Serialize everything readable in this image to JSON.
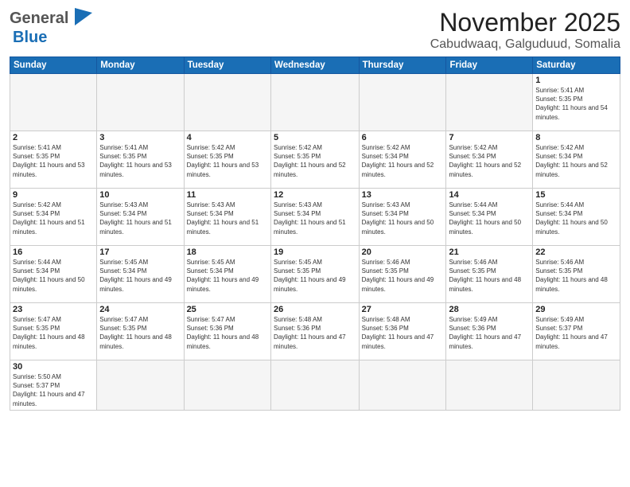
{
  "header": {
    "logo_general": "General",
    "logo_blue": "Blue",
    "title": "November 2025",
    "subtitle": "Cabudwaaq, Galguduud, Somalia"
  },
  "weekdays": [
    "Sunday",
    "Monday",
    "Tuesday",
    "Wednesday",
    "Thursday",
    "Friday",
    "Saturday"
  ],
  "days": [
    {
      "num": "",
      "sunrise": "",
      "sunset": "",
      "daylight": "",
      "empty": true
    },
    {
      "num": "",
      "sunrise": "",
      "sunset": "",
      "daylight": "",
      "empty": true
    },
    {
      "num": "",
      "sunrise": "",
      "sunset": "",
      "daylight": "",
      "empty": true
    },
    {
      "num": "",
      "sunrise": "",
      "sunset": "",
      "daylight": "",
      "empty": true
    },
    {
      "num": "",
      "sunrise": "",
      "sunset": "",
      "daylight": "",
      "empty": true
    },
    {
      "num": "",
      "sunrise": "",
      "sunset": "",
      "daylight": "",
      "empty": true
    },
    {
      "num": "1",
      "sunrise": "Sunrise: 5:41 AM",
      "sunset": "Sunset: 5:35 PM",
      "daylight": "Daylight: 11 hours and 54 minutes.",
      "empty": false
    },
    {
      "num": "2",
      "sunrise": "Sunrise: 5:41 AM",
      "sunset": "Sunset: 5:35 PM",
      "daylight": "Daylight: 11 hours and 53 minutes.",
      "empty": false
    },
    {
      "num": "3",
      "sunrise": "Sunrise: 5:41 AM",
      "sunset": "Sunset: 5:35 PM",
      "daylight": "Daylight: 11 hours and 53 minutes.",
      "empty": false
    },
    {
      "num": "4",
      "sunrise": "Sunrise: 5:42 AM",
      "sunset": "Sunset: 5:35 PM",
      "daylight": "Daylight: 11 hours and 53 minutes.",
      "empty": false
    },
    {
      "num": "5",
      "sunrise": "Sunrise: 5:42 AM",
      "sunset": "Sunset: 5:35 PM",
      "daylight": "Daylight: 11 hours and 52 minutes.",
      "empty": false
    },
    {
      "num": "6",
      "sunrise": "Sunrise: 5:42 AM",
      "sunset": "Sunset: 5:34 PM",
      "daylight": "Daylight: 11 hours and 52 minutes.",
      "empty": false
    },
    {
      "num": "7",
      "sunrise": "Sunrise: 5:42 AM",
      "sunset": "Sunset: 5:34 PM",
      "daylight": "Daylight: 11 hours and 52 minutes.",
      "empty": false
    },
    {
      "num": "8",
      "sunrise": "Sunrise: 5:42 AM",
      "sunset": "Sunset: 5:34 PM",
      "daylight": "Daylight: 11 hours and 52 minutes.",
      "empty": false
    },
    {
      "num": "9",
      "sunrise": "Sunrise: 5:42 AM",
      "sunset": "Sunset: 5:34 PM",
      "daylight": "Daylight: 11 hours and 51 minutes.",
      "empty": false
    },
    {
      "num": "10",
      "sunrise": "Sunrise: 5:43 AM",
      "sunset": "Sunset: 5:34 PM",
      "daylight": "Daylight: 11 hours and 51 minutes.",
      "empty": false
    },
    {
      "num": "11",
      "sunrise": "Sunrise: 5:43 AM",
      "sunset": "Sunset: 5:34 PM",
      "daylight": "Daylight: 11 hours and 51 minutes.",
      "empty": false
    },
    {
      "num": "12",
      "sunrise": "Sunrise: 5:43 AM",
      "sunset": "Sunset: 5:34 PM",
      "daylight": "Daylight: 11 hours and 51 minutes.",
      "empty": false
    },
    {
      "num": "13",
      "sunrise": "Sunrise: 5:43 AM",
      "sunset": "Sunset: 5:34 PM",
      "daylight": "Daylight: 11 hours and 50 minutes.",
      "empty": false
    },
    {
      "num": "14",
      "sunrise": "Sunrise: 5:44 AM",
      "sunset": "Sunset: 5:34 PM",
      "daylight": "Daylight: 11 hours and 50 minutes.",
      "empty": false
    },
    {
      "num": "15",
      "sunrise": "Sunrise: 5:44 AM",
      "sunset": "Sunset: 5:34 PM",
      "daylight": "Daylight: 11 hours and 50 minutes.",
      "empty": false
    },
    {
      "num": "16",
      "sunrise": "Sunrise: 5:44 AM",
      "sunset": "Sunset: 5:34 PM",
      "daylight": "Daylight: 11 hours and 50 minutes.",
      "empty": false
    },
    {
      "num": "17",
      "sunrise": "Sunrise: 5:45 AM",
      "sunset": "Sunset: 5:34 PM",
      "daylight": "Daylight: 11 hours and 49 minutes.",
      "empty": false
    },
    {
      "num": "18",
      "sunrise": "Sunrise: 5:45 AM",
      "sunset": "Sunset: 5:34 PM",
      "daylight": "Daylight: 11 hours and 49 minutes.",
      "empty": false
    },
    {
      "num": "19",
      "sunrise": "Sunrise: 5:45 AM",
      "sunset": "Sunset: 5:35 PM",
      "daylight": "Daylight: 11 hours and 49 minutes.",
      "empty": false
    },
    {
      "num": "20",
      "sunrise": "Sunrise: 5:46 AM",
      "sunset": "Sunset: 5:35 PM",
      "daylight": "Daylight: 11 hours and 49 minutes.",
      "empty": false
    },
    {
      "num": "21",
      "sunrise": "Sunrise: 5:46 AM",
      "sunset": "Sunset: 5:35 PM",
      "daylight": "Daylight: 11 hours and 48 minutes.",
      "empty": false
    },
    {
      "num": "22",
      "sunrise": "Sunrise: 5:46 AM",
      "sunset": "Sunset: 5:35 PM",
      "daylight": "Daylight: 11 hours and 48 minutes.",
      "empty": false
    },
    {
      "num": "23",
      "sunrise": "Sunrise: 5:47 AM",
      "sunset": "Sunset: 5:35 PM",
      "daylight": "Daylight: 11 hours and 48 minutes.",
      "empty": false
    },
    {
      "num": "24",
      "sunrise": "Sunrise: 5:47 AM",
      "sunset": "Sunset: 5:35 PM",
      "daylight": "Daylight: 11 hours and 48 minutes.",
      "empty": false
    },
    {
      "num": "25",
      "sunrise": "Sunrise: 5:47 AM",
      "sunset": "Sunset: 5:36 PM",
      "daylight": "Daylight: 11 hours and 48 minutes.",
      "empty": false
    },
    {
      "num": "26",
      "sunrise": "Sunrise: 5:48 AM",
      "sunset": "Sunset: 5:36 PM",
      "daylight": "Daylight: 11 hours and 47 minutes.",
      "empty": false
    },
    {
      "num": "27",
      "sunrise": "Sunrise: 5:48 AM",
      "sunset": "Sunset: 5:36 PM",
      "daylight": "Daylight: 11 hours and 47 minutes.",
      "empty": false
    },
    {
      "num": "28",
      "sunrise": "Sunrise: 5:49 AM",
      "sunset": "Sunset: 5:36 PM",
      "daylight": "Daylight: 11 hours and 47 minutes.",
      "empty": false
    },
    {
      "num": "29",
      "sunrise": "Sunrise: 5:49 AM",
      "sunset": "Sunset: 5:37 PM",
      "daylight": "Daylight: 11 hours and 47 minutes.",
      "empty": false
    },
    {
      "num": "30",
      "sunrise": "Sunrise: 5:50 AM",
      "sunset": "Sunset: 5:37 PM",
      "daylight": "Daylight: 11 hours and 47 minutes.",
      "empty": false
    }
  ]
}
